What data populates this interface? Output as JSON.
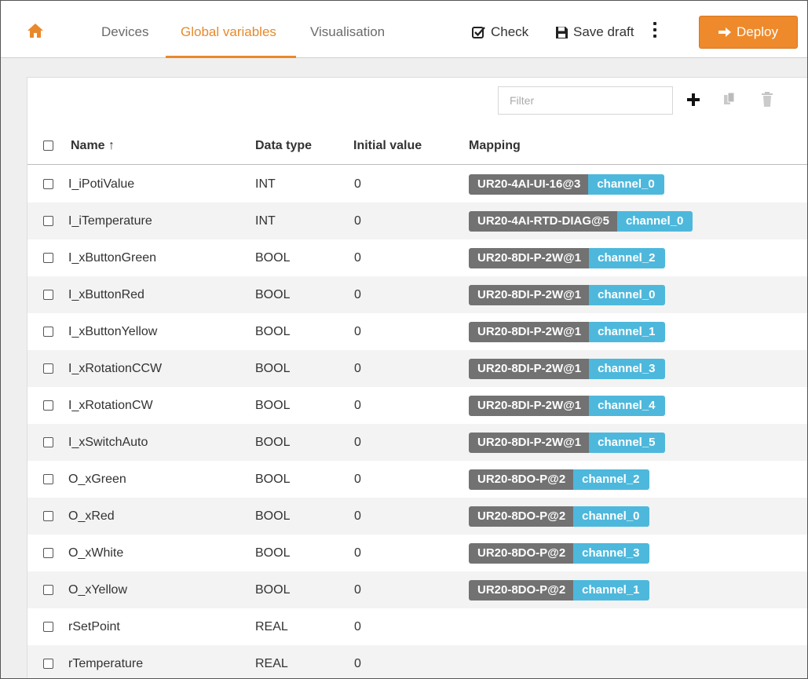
{
  "nav": {
    "tabs": [
      {
        "label": "Devices"
      },
      {
        "label": "Global variables",
        "active": true
      },
      {
        "label": "Visualisation"
      }
    ],
    "accent_color": "#e8892b"
  },
  "toolbar": {
    "check_label": "Check",
    "save_label": "Save draft",
    "deploy_label": "Deploy"
  },
  "table": {
    "filter_placeholder": "Filter",
    "columns": {
      "name": "Name ↑",
      "type": "Data type",
      "initial": "Initial value",
      "mapping": "Mapping"
    },
    "rows": [
      {
        "name": "I_iPotiValue",
        "type": "INT",
        "initial": "0",
        "device": "UR20-4AI-UI-16@3",
        "channel": "channel_0"
      },
      {
        "name": "I_iTemperature",
        "type": "INT",
        "initial": "0",
        "device": "UR20-4AI-RTD-DIAG@5",
        "channel": "channel_0"
      },
      {
        "name": "I_xButtonGreen",
        "type": "BOOL",
        "initial": "0",
        "device": "UR20-8DI-P-2W@1",
        "channel": "channel_2"
      },
      {
        "name": "I_xButtonRed",
        "type": "BOOL",
        "initial": "0",
        "device": "UR20-8DI-P-2W@1",
        "channel": "channel_0"
      },
      {
        "name": "I_xButtonYellow",
        "type": "BOOL",
        "initial": "0",
        "device": "UR20-8DI-P-2W@1",
        "channel": "channel_1"
      },
      {
        "name": "I_xRotationCCW",
        "type": "BOOL",
        "initial": "0",
        "device": "UR20-8DI-P-2W@1",
        "channel": "channel_3"
      },
      {
        "name": "I_xRotationCW",
        "type": "BOOL",
        "initial": "0",
        "device": "UR20-8DI-P-2W@1",
        "channel": "channel_4"
      },
      {
        "name": "I_xSwitchAuto",
        "type": "BOOL",
        "initial": "0",
        "device": "UR20-8DI-P-2W@1",
        "channel": "channel_5"
      },
      {
        "name": "O_xGreen",
        "type": "BOOL",
        "initial": "0",
        "device": "UR20-8DO-P@2",
        "channel": "channel_2"
      },
      {
        "name": "O_xRed",
        "type": "BOOL",
        "initial": "0",
        "device": "UR20-8DO-P@2",
        "channel": "channel_0"
      },
      {
        "name": "O_xWhite",
        "type": "BOOL",
        "initial": "0",
        "device": "UR20-8DO-P@2",
        "channel": "channel_3"
      },
      {
        "name": "O_xYellow",
        "type": "BOOL",
        "initial": "0",
        "device": "UR20-8DO-P@2",
        "channel": "channel_1"
      },
      {
        "name": "rSetPoint",
        "type": "REAL",
        "initial": "0",
        "device": null,
        "channel": null
      },
      {
        "name": "rTemperature",
        "type": "REAL",
        "initial": "0",
        "device": null,
        "channel": null
      }
    ],
    "device_tag_color": "#727272",
    "channel_tag_color": "#4db8dc"
  },
  "icons": {
    "home": "home-icon",
    "check": "check-square-icon",
    "save": "floppy-disk-icon",
    "more": "kebab-menu-icon",
    "deploy": "arrow-right-icon",
    "add": "plus-icon",
    "copy": "copy-icon",
    "delete": "trash-icon"
  }
}
